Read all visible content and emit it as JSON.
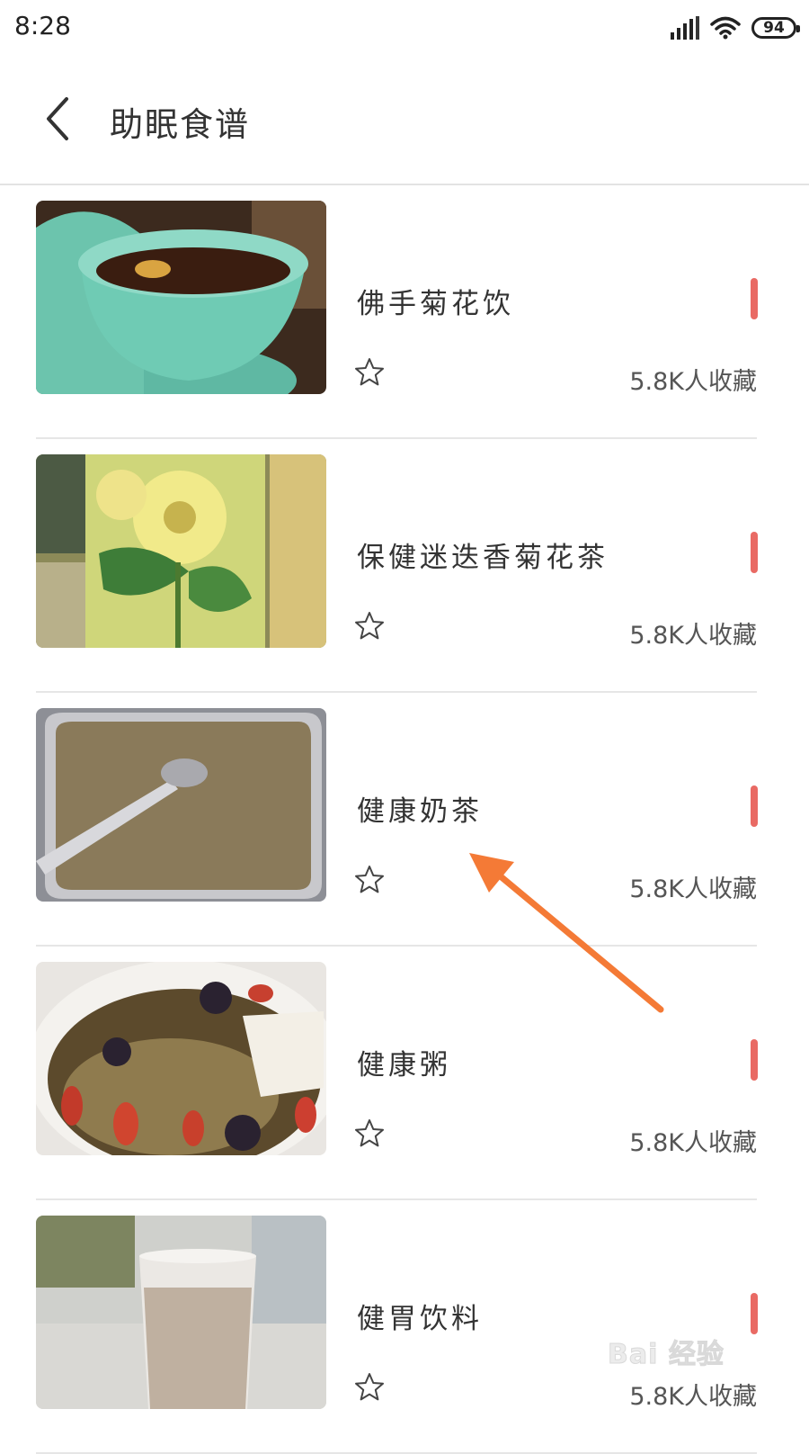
{
  "status_bar": {
    "time": "8:28",
    "battery": "94",
    "icons": [
      "signal-icon",
      "wifi-icon",
      "battery-icon"
    ]
  },
  "header": {
    "back_icon": "chevron-left-icon",
    "title": "助眠食谱"
  },
  "colors": {
    "accent": "#e96a64",
    "annotation_arrow": "#f47a36",
    "divider": "#e6e6e6"
  },
  "recipes": [
    {
      "title": "佛手菊花饮",
      "favorites": "5.8K人收藏",
      "image": "chrysanthemum-tea-in-celadon-cup"
    },
    {
      "title": "保健迷迭香菊花茶",
      "favorites": "5.8K人收藏",
      "image": "chrysanthemum-mint-glass"
    },
    {
      "title": "健康奶茶",
      "favorites": "5.8K人收藏",
      "image": "milk-tea-bowl-with-spoon"
    },
    {
      "title": "健康粥",
      "favorites": "5.8K人收藏",
      "image": "goji-porridge-bowl"
    },
    {
      "title": "健胃饮料",
      "favorites": "5.8K人收藏",
      "image": "milk-drink-glass"
    }
  ],
  "watermark": "Bai 经验"
}
